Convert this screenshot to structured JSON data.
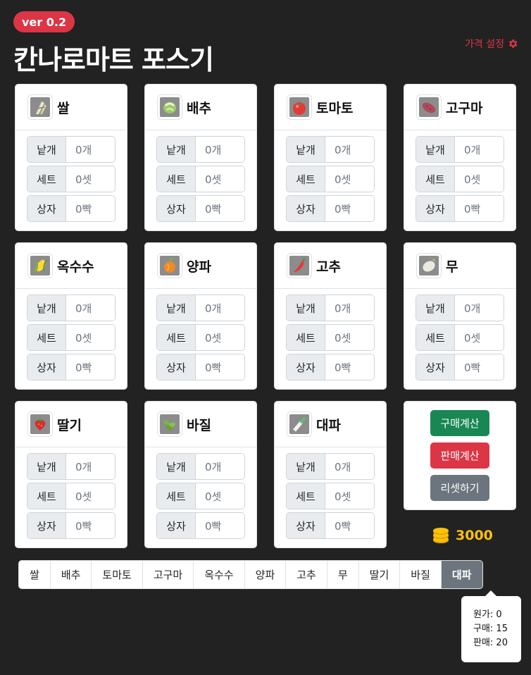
{
  "header": {
    "version": "ver 0.2",
    "title": "칸나로마트 포스기",
    "price_setting_label": "가격 설정",
    "price_setting_icon": "gear-icon"
  },
  "row_labels": {
    "unit": "낱개",
    "set": "세트",
    "box": "상자"
  },
  "items": [
    {
      "name": "쌀",
      "icon": "rice-icon",
      "unit": "0개",
      "set": "0셋",
      "box": "0빡"
    },
    {
      "name": "배추",
      "icon": "cabbage-icon",
      "unit": "0개",
      "set": "0셋",
      "box": "0빡"
    },
    {
      "name": "토마토",
      "icon": "tomato-icon",
      "unit": "0개",
      "set": "0셋",
      "box": "0빡"
    },
    {
      "name": "고구마",
      "icon": "sweet-potato-icon",
      "unit": "0개",
      "set": "0셋",
      "box": "0빡"
    },
    {
      "name": "옥수수",
      "icon": "corn-icon",
      "unit": "0개",
      "set": "0셋",
      "box": "0빡"
    },
    {
      "name": "양파",
      "icon": "onion-icon",
      "unit": "0개",
      "set": "0셋",
      "box": "0빡"
    },
    {
      "name": "고추",
      "icon": "chili-pepper-icon",
      "unit": "0개",
      "set": "0셋",
      "box": "0빡"
    },
    {
      "name": "무",
      "icon": "radish-icon",
      "unit": "0개",
      "set": "0셋",
      "box": "0빡"
    },
    {
      "name": "딸기",
      "icon": "strawberry-icon",
      "unit": "0개",
      "set": "0셋",
      "box": "0빡"
    },
    {
      "name": "바질",
      "icon": "basil-icon",
      "unit": "0개",
      "set": "0셋",
      "box": "0빡"
    },
    {
      "name": "대파",
      "icon": "green-onion-icon",
      "unit": "0개",
      "set": "0셋",
      "box": "0빡"
    }
  ],
  "actions": {
    "buy_calc": "구매계산",
    "sell_calc": "판매계산",
    "reset": "리셋하기"
  },
  "gold": {
    "amount": "3000",
    "icon": "coins-icon"
  },
  "tabs": [
    "쌀",
    "배추",
    "토마토",
    "고구마",
    "옥수수",
    "양파",
    "고추",
    "무",
    "딸기",
    "바질",
    "대파"
  ],
  "active_tab": "대파",
  "tooltip": {
    "cost": "원가: 0",
    "buy": "구매: 15",
    "sell": "판매: 20"
  },
  "colors": {
    "background": "#222222",
    "accent_red": "#dc3545",
    "accent_green": "#198754",
    "gray": "#6c757d",
    "gold": "#ffc107"
  }
}
